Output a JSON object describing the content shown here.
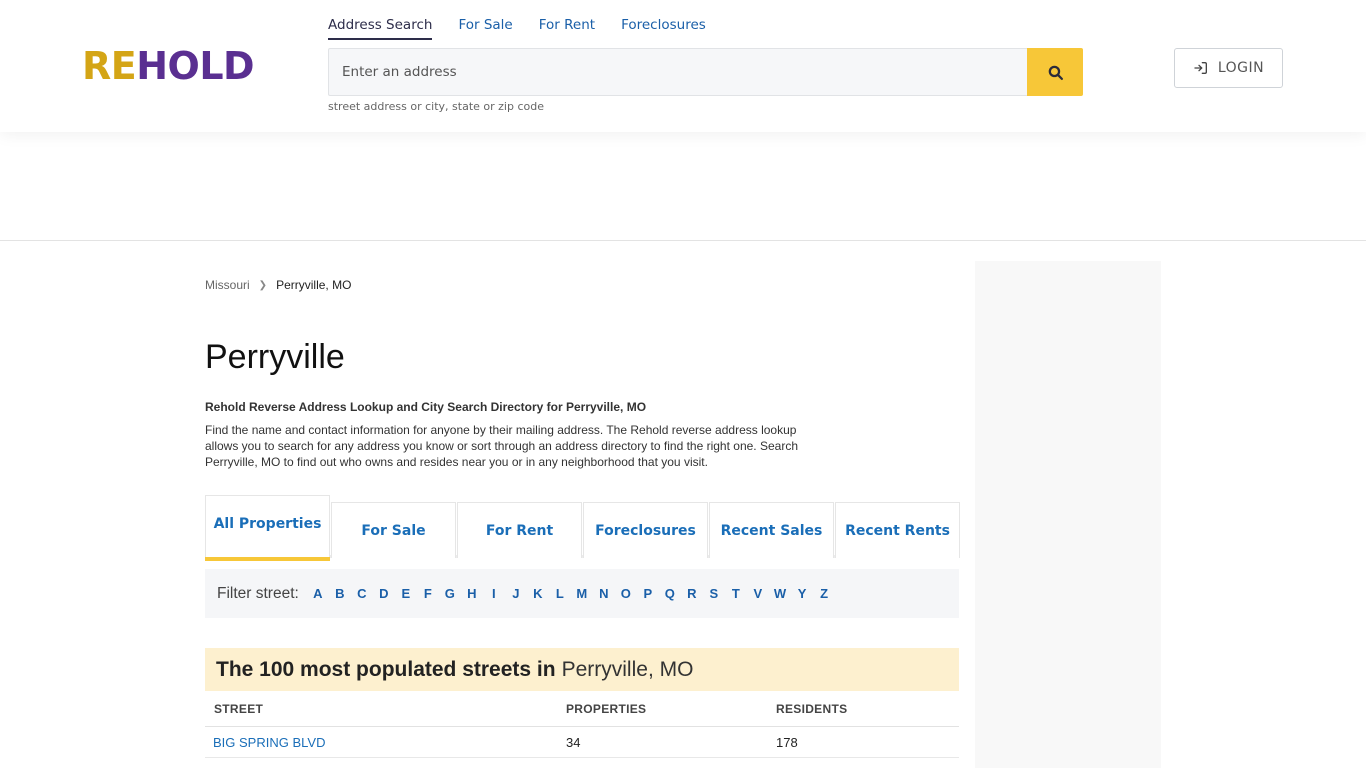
{
  "header": {
    "logo": {
      "part1": "RE",
      "part2": "HOLD"
    },
    "nav": [
      {
        "label": "Address Search",
        "active": true
      },
      {
        "label": "For Sale",
        "active": false
      },
      {
        "label": "For Rent",
        "active": false
      },
      {
        "label": "Foreclosures",
        "active": false
      }
    ],
    "search": {
      "placeholder": "Enter an address",
      "value": "",
      "hint": "street address or city, state or zip code",
      "button_icon": "search-icon"
    },
    "login": {
      "label": "LOGIN",
      "icon": "login-icon"
    }
  },
  "breadcrumb": {
    "items": [
      {
        "label": "Missouri",
        "link": true
      },
      {
        "label": "Perryville, MO",
        "link": false
      }
    ]
  },
  "page": {
    "title": "Perryville",
    "subtitle": "Rehold Reverse Address Lookup and City Search Directory for Perryville, MO",
    "description": "Find the name and contact information for anyone by their mailing address. The Rehold reverse address lookup allows you to search for any address you know or sort through an address directory to find the right one. Search Perryville, MO to find out who owns and resides near you or in any neighborhood that you visit."
  },
  "tabs": [
    {
      "label": "All Properties",
      "active": true
    },
    {
      "label": "For Sale",
      "active": false
    },
    {
      "label": "For Rent",
      "active": false
    },
    {
      "label": "Foreclosures",
      "active": false
    },
    {
      "label": "Recent Sales",
      "active": false
    },
    {
      "label": "Recent Rents",
      "active": false
    }
  ],
  "filter": {
    "label": "Filter street:",
    "letters": [
      "A",
      "B",
      "C",
      "D",
      "E",
      "F",
      "G",
      "H",
      "I",
      "J",
      "K",
      "L",
      "M",
      "N",
      "O",
      "P",
      "Q",
      "R",
      "S",
      "T",
      "V",
      "W",
      "Y",
      "Z"
    ]
  },
  "section": {
    "heading_bold": "The 100 most populated streets in",
    "heading_city": "Perryville, MO"
  },
  "table": {
    "columns": [
      "STREET",
      "PROPERTIES",
      "RESIDENTS"
    ],
    "rows": [
      {
        "street": "BIG SPRING BLVD",
        "properties": "34",
        "residents": "178"
      }
    ]
  },
  "colors": {
    "accent_yellow": "#f7c738",
    "link_blue": "#1a6eb8",
    "logo_gold": "#d4a516",
    "logo_purple": "#5a2f91",
    "section_bg": "#fdf0cf"
  }
}
